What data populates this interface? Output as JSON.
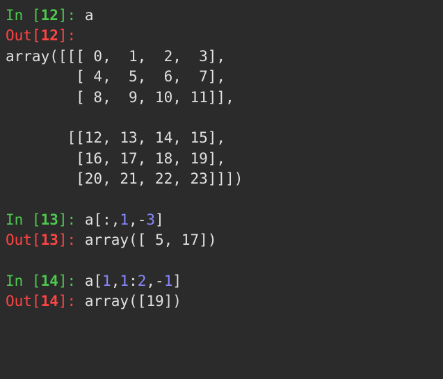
{
  "cells": [
    {
      "in_prefix": "In [",
      "in_num": "12",
      "in_suffix": "]: ",
      "code": "a",
      "out_prefix": "Out[",
      "out_num": "12",
      "out_suffix": "]:",
      "output": "array([[[ 0,  1,  2,  3],\n        [ 4,  5,  6,  7],\n        [ 8,  9, 10, 11]],\n\n       [[12, 13, 14, 15],\n        [16, 17, 18, 19],\n        [20, 21, 22, 23]]])"
    },
    {
      "in_prefix": "In [",
      "in_num": "13",
      "in_suffix": "]: ",
      "code_parts": [
        "a[:,",
        "1",
        ",-",
        "3",
        "]"
      ],
      "out_prefix": "Out[",
      "out_num": "13",
      "out_suffix": "]: ",
      "output": "array([ 5, 17])"
    },
    {
      "in_prefix": "In [",
      "in_num": "14",
      "in_suffix": "]: ",
      "code_parts": [
        "a[",
        "1",
        ",",
        "1",
        ":",
        "2",
        ",-",
        "1",
        "]"
      ],
      "out_prefix": "Out[",
      "out_num": "14",
      "out_suffix": "]: ",
      "output": "array([19])"
    }
  ]
}
